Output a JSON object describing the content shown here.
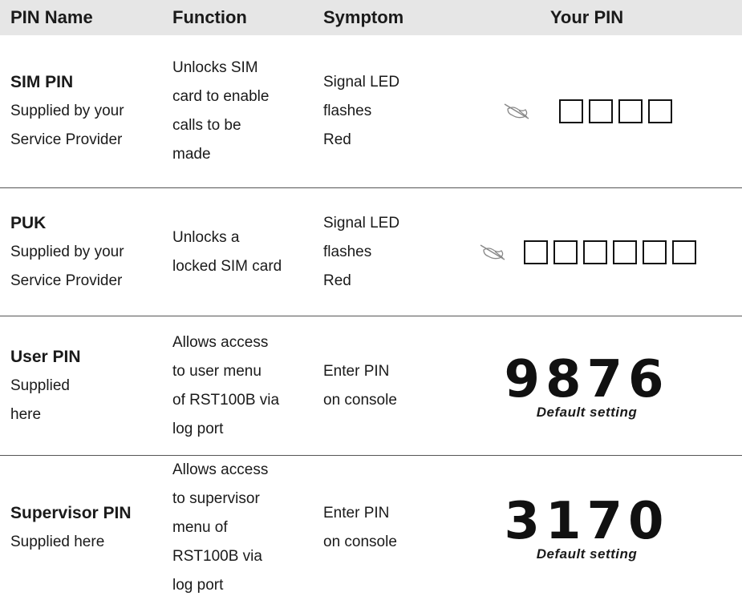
{
  "header": {
    "pin_name": "PIN Name",
    "function": "Function",
    "symptom": "Symptom",
    "your_pin": "Your PIN"
  },
  "rows": [
    {
      "name": "SIM PIN",
      "name_sub": [
        "Supplied by your",
        "Service Provider"
      ],
      "function": [
        "Unlocks SIM",
        "card to enable",
        "calls to be",
        "made"
      ],
      "symptom": [
        "Signal LED",
        "flashes",
        "Red"
      ],
      "pin_boxes": 4,
      "icon": "pencil-icon"
    },
    {
      "name": "PUK",
      "name_sub": [
        "Supplied by your",
        "Service Provider"
      ],
      "function": [
        "Unlocks a",
        "locked SIM card"
      ],
      "symptom": [
        "Signal LED",
        "flashes",
        "Red"
      ],
      "pin_boxes": 6,
      "icon": "pencil-icon"
    },
    {
      "name": "User PIN",
      "name_sub": [
        "Supplied",
        "here"
      ],
      "function": [
        "Allows access",
        "to user menu",
        "of RST100B via",
        "log port"
      ],
      "symptom": [
        "Enter PIN",
        "on console"
      ],
      "pin_value": "9876",
      "pin_note": "Default setting"
    },
    {
      "name": "Supervisor PIN",
      "name_sub": [
        "Supplied here"
      ],
      "function": [
        "Allows access",
        "to supervisor",
        "menu of",
        "RST100B via",
        "log port"
      ],
      "symptom": [
        "Enter PIN",
        "on console"
      ],
      "pin_value": "3170",
      "pin_note": "Default setting"
    }
  ]
}
